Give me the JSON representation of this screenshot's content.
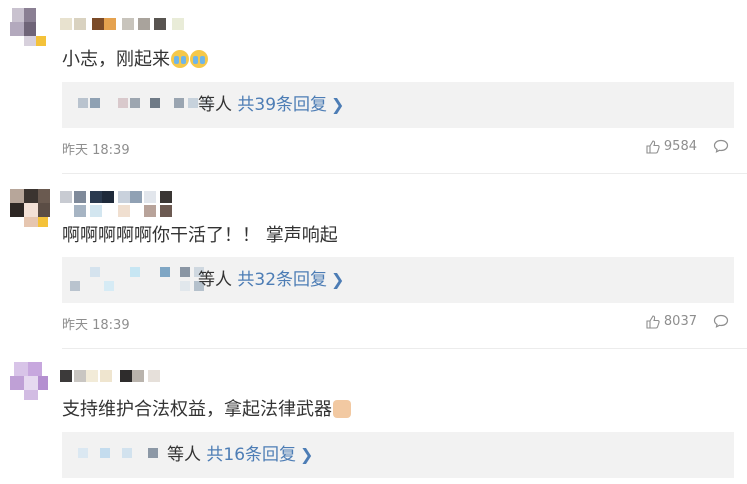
{
  "comments": [
    {
      "text": "小志，刚起来",
      "reply_people": "等人",
      "reply_count": "共39条回复",
      "time": "昨天 18:39",
      "likes": "9584"
    },
    {
      "text": "啊啊啊啊啊你干活了！！ 掌声响起",
      "reply_people": "等人",
      "reply_count": "共32条回复",
      "time": "昨天 18:39",
      "likes": "8037"
    },
    {
      "text": "支持维护合法权益，拿起法律武器",
      "reply_people": "等人",
      "reply_count": "共16条回复"
    }
  ],
  "icons": {
    "like": "thumbs-up-icon",
    "reply": "comment-bubble-icon",
    "chevron": "chevron-right-icon",
    "emoji_1": "crying-emoji-icon",
    "emoji_3": "thumbs-up-emoji-icon"
  },
  "colors": {
    "link": "#4d7db5",
    "meta": "#8e8e8e",
    "reply_bg": "#f2f2f2"
  }
}
